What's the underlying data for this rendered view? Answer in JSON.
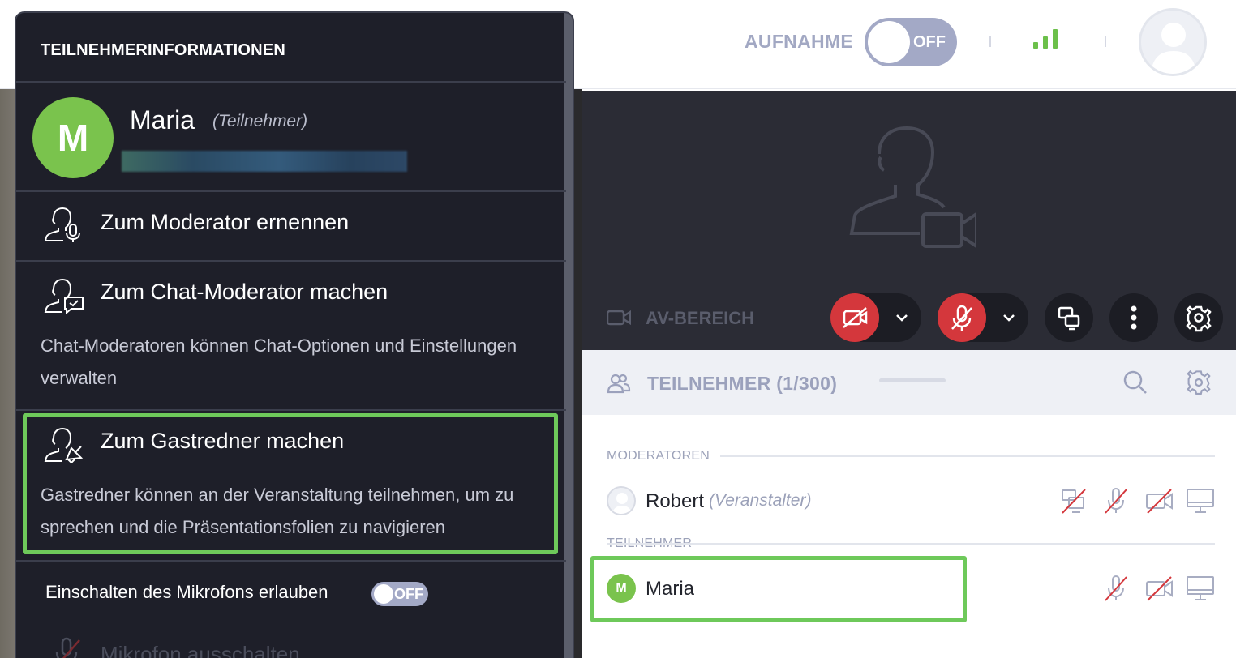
{
  "topbar": {
    "recording_label": "AUFNAHME",
    "recording_toggle": "OFF",
    "signal_icon": "signal-strength-icon",
    "avatar_icon": "user-avatar-icon"
  },
  "av_area": {
    "label": "AV-BEREICH"
  },
  "participants": {
    "header": "TEILNEHMER (1/300)",
    "sections": {
      "moderators": "MODERATOREN",
      "attendees": "TEILNEHMER"
    },
    "moderator_row": {
      "name": "Robert",
      "role": "(Veranstalter)"
    },
    "attendee_row": {
      "name": "Maria",
      "initial": "M"
    }
  },
  "popup": {
    "title": "TEILNEHMERINFORMATIONEN",
    "user": {
      "initial": "M",
      "name": "Maria",
      "role": "(Teilnehmer)"
    },
    "menu": [
      {
        "label": "Zum Moderator ernennen",
        "icon": "user-mic-icon"
      },
      {
        "label": "Zum Chat-Moderator machen",
        "icon": "user-chat-icon",
        "description": "Chat-Moderatoren können Chat-Optionen und Einstellungen verwalten"
      },
      {
        "label": "Zum Gastredner machen",
        "icon": "user-speaker-icon",
        "description": "Gastredner können an der Veranstaltung teilnehmen, um zu sprechen und die Präsentationsfolien zu navigieren"
      }
    ],
    "mic_allow": {
      "label": "Einschalten des Mikrofons erlauben",
      "toggle": "OFF"
    },
    "mute": {
      "label": "Mikrofon ausschalten"
    }
  },
  "colors": {
    "accent_green": "#6ec95a",
    "avatar_green": "#7ac34d",
    "danger_red": "#d4373c",
    "panel_dark": "#1e1f29"
  }
}
